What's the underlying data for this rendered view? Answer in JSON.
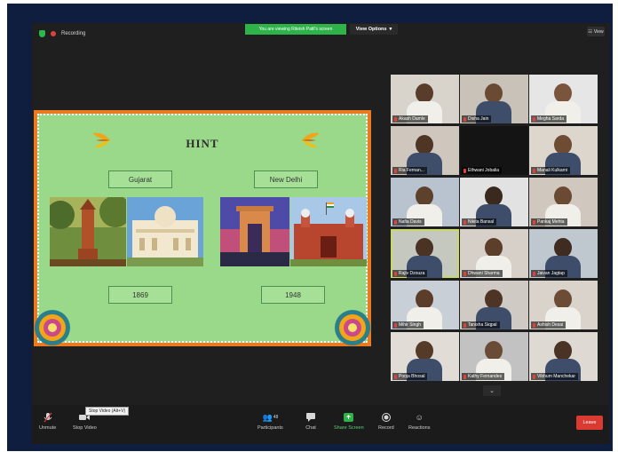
{
  "topbar": {
    "recording_label": "Recording",
    "banner": "You are viewing Riteish Patil's screen",
    "view_options_label": "View Options",
    "view_label": "View"
  },
  "slide": {
    "title": "HINT",
    "left_state": "Gujarat",
    "right_state": "New Delhi",
    "left_year": "1869",
    "right_year": "1948"
  },
  "gallery": [
    "Akash Damle",
    "Disha Jain",
    "Megha Sarda",
    "Ria Fernan...",
    "Ethwani Jobalia",
    "Manali Kulkarni",
    "Nafia Davis",
    "Nikita Bansal",
    "Pankaj Mehta",
    "Rajiv Dzouza",
    "Dhwani Sharma",
    "Jaivan Jagtap",
    "Mihir Singh",
    "Tanisha Siqpal",
    "Ashish Desai",
    "Pooja Bhosal",
    "Kathy Fernandes",
    "Vibhum Manchekar"
  ],
  "toolbar": {
    "unmute": "Unmute",
    "stop_video": "Stop Video",
    "tooltip": "Stop Video (Alt+V)",
    "participants": "Participants",
    "participants_count": "48",
    "chat": "Chat",
    "share_screen": "Share Screen",
    "record": "Record",
    "reactions": "Reactions",
    "leave": "Leave"
  },
  "colors": {
    "share_green": "#2db34a",
    "leave_red": "#d93a32",
    "slide_orange": "#ea7a1f",
    "slide_green": "#9bd98a"
  }
}
